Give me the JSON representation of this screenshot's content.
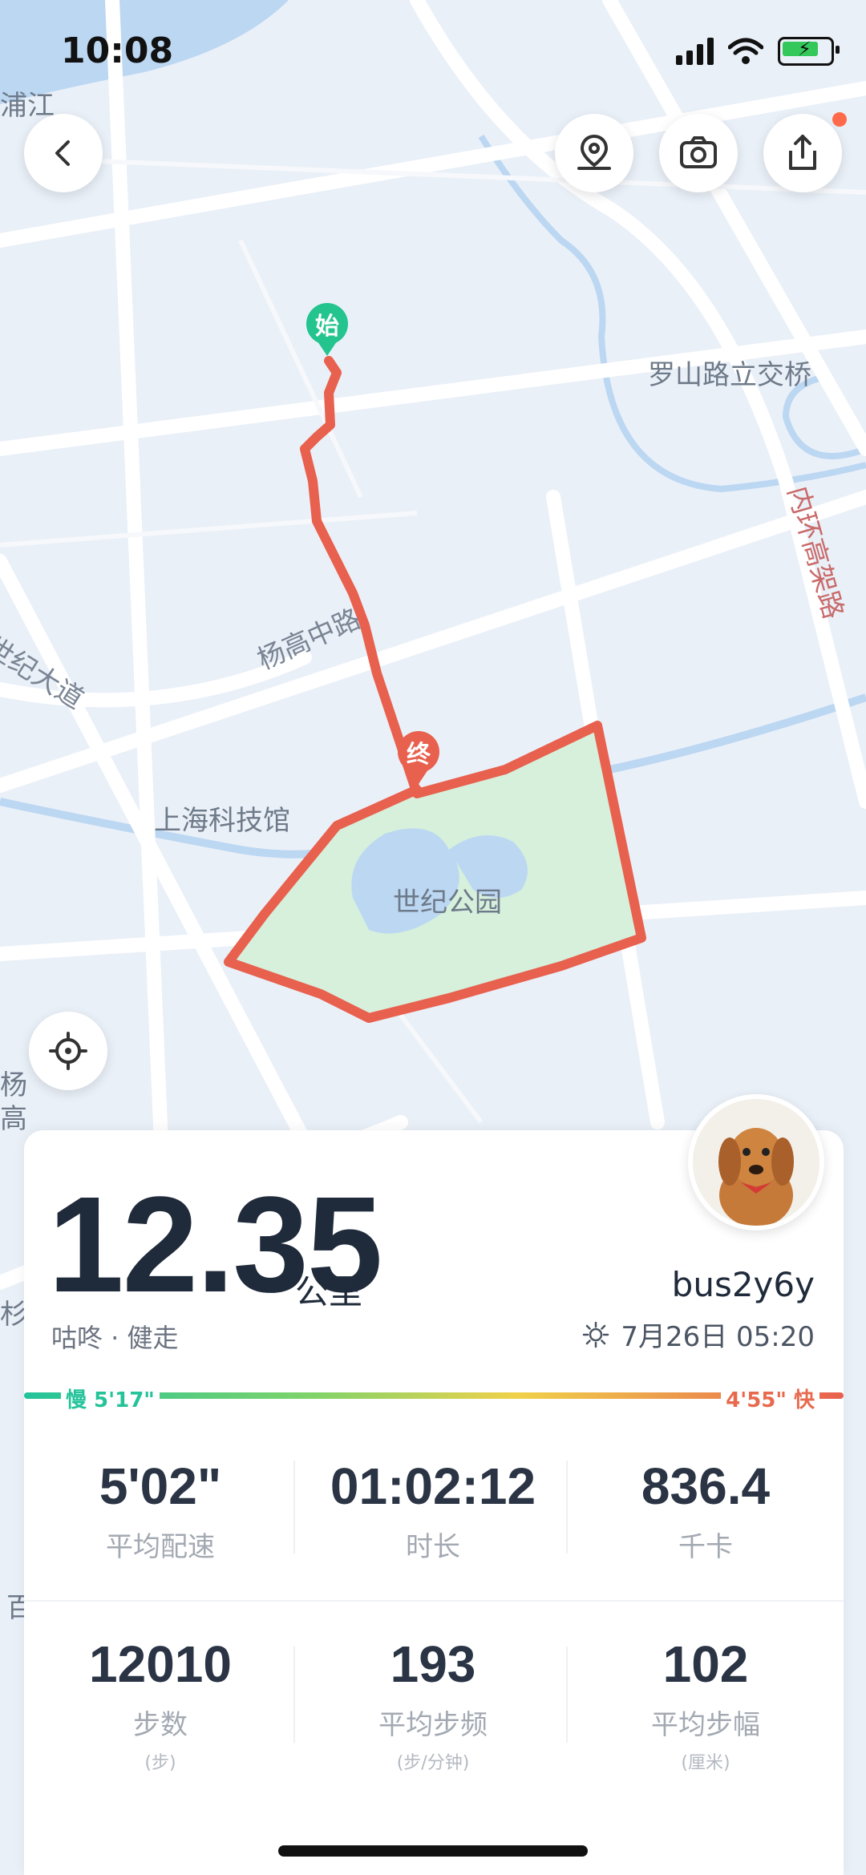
{
  "status_bar": {
    "time": "10:08"
  },
  "map": {
    "labels": {
      "top_left": "浦江",
      "luoshan": "罗山路立交桥",
      "inner_ring": "内环高架路",
      "yanggao": "杨高中路",
      "century_ave": "世纪大道",
      "science_museum": "上海科技馆",
      "century_park": "世纪公园",
      "left_edge_1": "杨",
      "left_edge_2": "高",
      "left_edge_3": "杉",
      "left_edge_4": "百"
    },
    "markers": {
      "start": "始",
      "end": "终"
    },
    "route_color": "#e8604e",
    "park_color": "#d6f0dc",
    "water_color": "#bcd7f2"
  },
  "toolbar": {
    "back_icon": "chevron-left-icon",
    "location_pin_icon": "location-pin-icon",
    "camera_icon": "camera-icon",
    "share_icon": "share-icon",
    "locate_icon": "crosshair-icon"
  },
  "summary": {
    "distance": "12.35",
    "unit": "公里",
    "subtitle": "咕咚 · 健走",
    "username": "bus2y6y",
    "datetime": "7月26日 05:20"
  },
  "pace": {
    "slow_label": "慢 5'17\"",
    "fast_label": "4'55\" 快"
  },
  "stats": [
    {
      "value": "5'02\"",
      "label": "平均配速"
    },
    {
      "value": "01:02:12",
      "label": "时长"
    },
    {
      "value": "836.4",
      "label": "千卡"
    },
    {
      "value": "12010",
      "label": "步数",
      "sub": "(步)"
    },
    {
      "value": "193",
      "label": "平均步频",
      "sub": "(步/分钟)"
    },
    {
      "value": "102",
      "label": "平均步幅",
      "sub": "(厘米)"
    }
  ]
}
